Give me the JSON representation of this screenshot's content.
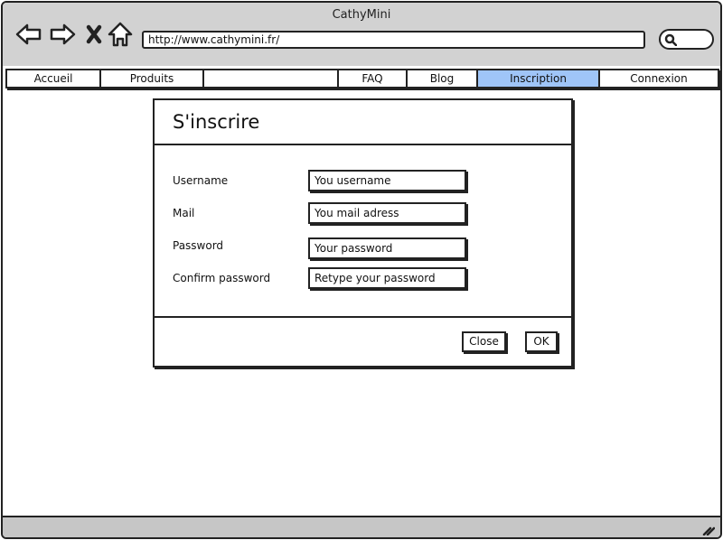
{
  "window": {
    "title": "CathyMini"
  },
  "toolbar": {
    "back_icon": "back-arrow-icon",
    "forward_icon": "forward-arrow-icon",
    "stop_icon": "close-x-icon",
    "home_icon": "home-icon",
    "url": "http://www.cathymini.fr/",
    "search_icon": "search-icon"
  },
  "nav": {
    "tabs": [
      {
        "label": "Accueil",
        "active": false
      },
      {
        "label": "Produits",
        "active": false
      },
      {
        "label": "",
        "active": false
      },
      {
        "label": "FAQ",
        "active": false
      },
      {
        "label": "Blog",
        "active": false
      },
      {
        "label": "Inscription",
        "active": true
      },
      {
        "label": "Connexion",
        "active": false
      }
    ],
    "active_color": "#9fc5f8"
  },
  "dialog": {
    "title": "S'inscrire",
    "fields": [
      {
        "label": "Username",
        "placeholder": "You username"
      },
      {
        "label": "Mail",
        "placeholder": "You mail adress"
      },
      {
        "label": "Password",
        "placeholder": "Your password"
      },
      {
        "label": "Confirm password",
        "placeholder": "Retype your password"
      }
    ],
    "close_label": "Close",
    "ok_label": "OK"
  },
  "statusbar": {
    "resize_icon": "resize-grip-icon"
  }
}
